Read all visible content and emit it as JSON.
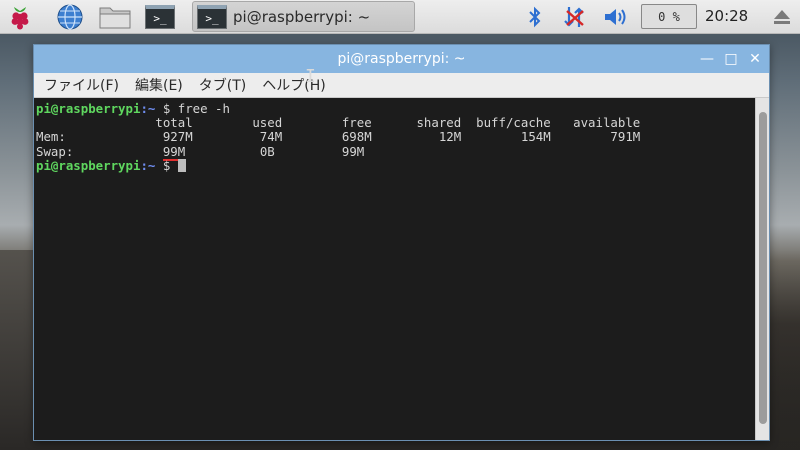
{
  "taskbar": {
    "task_title": "pi@raspberrypi: ~",
    "cpu_usage": "0 %",
    "clock": "20:28",
    "icons": [
      "raspberry-menu-icon",
      "browser-globe-icon",
      "file-manager-icon",
      "terminal-launcher-icon",
      "bluetooth-icon",
      "network-disconnected-icon",
      "volume-icon",
      "eject-icon"
    ]
  },
  "window": {
    "title": "pi@raspberrypi: ~",
    "menu": [
      "ファイル(F)",
      "編集(E)",
      "タブ(T)",
      "ヘルプ(H)"
    ]
  },
  "terminal": {
    "prompt_user": "pi@raspberrypi",
    "prompt_path": ":~",
    "prompt_symbol": " $",
    "command": " free -h",
    "header": "                total        used        free      shared  buff/cache   available",
    "mem_row": "Mem:             927M         74M        698M         12M        154M        791M",
    "swap_label": "Swap:            ",
    "swap_total": "99M",
    "swap_rest": "          0B         99M"
  },
  "colors": {
    "prompt_user": "#5fd75f",
    "prompt_path": "#6f8df0",
    "titlebar": "#87b5e0",
    "terminal_bg": "#1c1c1c"
  }
}
